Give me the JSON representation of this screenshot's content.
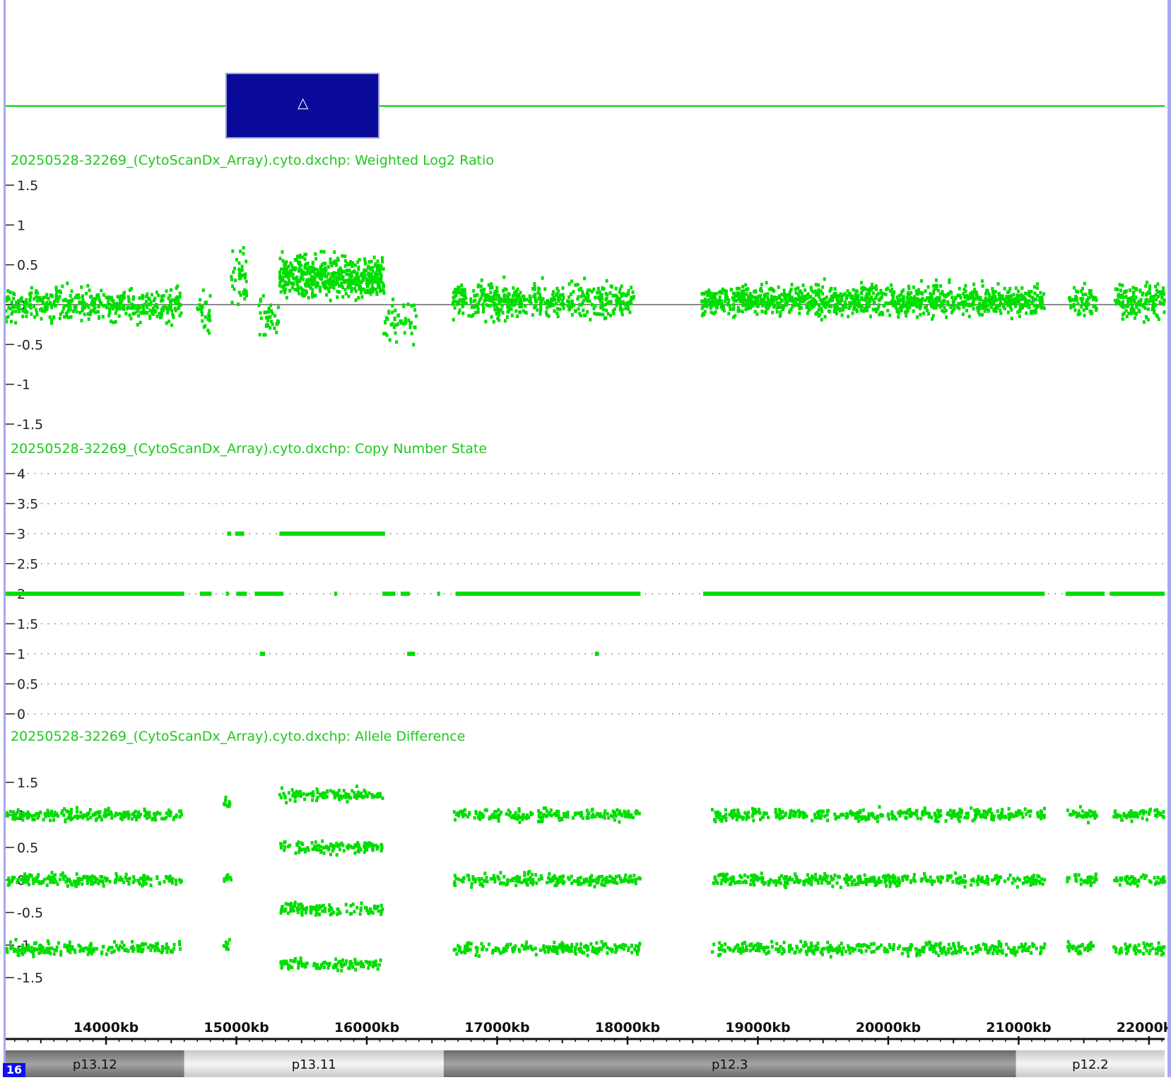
{
  "colors": {
    "points": "#00dd00",
    "title": "#1ec81e",
    "baseline": "#666666",
    "border": "#a8a8ee",
    "segment": "#00cc00"
  },
  "segment_icon": "triangle-up-icon",
  "tracks": {
    "log2_title": "20250528-32269_(CytoScanDx_Array).cyto.dxchp: Weighted Log2 Ratio",
    "cn_title": "20250528-32269_(CytoScanDx_Array).cyto.dxchp: Copy Number State",
    "allele_title": "20250528-32269_(CytoScanDx_Array).cyto.dxchp: Allele Difference"
  },
  "chromosome": "16",
  "chart_data": [
    {
      "type": "scatter",
      "title": "20250528-32269_(CytoScanDx_Array).cyto.dxchp: Weighted Log2 Ratio",
      "ylim": [
        -1.5,
        1.5
      ],
      "yticks": [
        "1.5",
        "1",
        "0.5",
        "0",
        "-0.5",
        "-1",
        "-1.5"
      ],
      "xlim_kb": [
        13230,
        22120
      ],
      "clusters": [
        {
          "x": [
            13230,
            14580
          ],
          "mean": 0.0,
          "spread": 0.2,
          "n": 420
        },
        {
          "x": [
            14700,
            14800
          ],
          "mean": -0.1,
          "spread": 0.25,
          "n": 30
        },
        {
          "x": [
            14960,
            15080
          ],
          "mean": 0.3,
          "spread": 0.35,
          "n": 40
        },
        {
          "x": [
            15170,
            15330
          ],
          "mean": -0.2,
          "spread": 0.25,
          "n": 40
        },
        {
          "x": [
            15330,
            16130
          ],
          "mean": 0.35,
          "spread": 0.25,
          "n": 520
        },
        {
          "x": [
            16130,
            16380
          ],
          "mean": -0.2,
          "spread": 0.3,
          "n": 50
        },
        {
          "x": [
            16650,
            18050
          ],
          "mean": 0.05,
          "spread": 0.2,
          "n": 480
        },
        {
          "x": [
            18570,
            21200
          ],
          "mean": 0.05,
          "spread": 0.18,
          "n": 1100
        },
        {
          "x": [
            21370,
            21600
          ],
          "mean": 0.05,
          "spread": 0.2,
          "n": 60
        },
        {
          "x": [
            21730,
            22120
          ],
          "mean": 0.05,
          "spread": 0.2,
          "n": 150
        }
      ]
    },
    {
      "type": "line",
      "title": "20250528-32269_(CytoScanDx_Array).cyto.dxchp: Copy Number State",
      "ylim": [
        0,
        4
      ],
      "yticks": [
        "4",
        "3.5",
        "3",
        "2.5",
        "2",
        "1.5",
        "1",
        "0.5",
        "0"
      ],
      "segments": [
        {
          "start": 13230,
          "end": 14600,
          "state": 2
        },
        {
          "start": 14720,
          "end": 14810,
          "state": 2
        },
        {
          "start": 14920,
          "end": 14940,
          "state": 2
        },
        {
          "start": 15000,
          "end": 15080,
          "state": 2
        },
        {
          "start": 15140,
          "end": 15360,
          "state": 2
        },
        {
          "start": 14930,
          "end": 14960,
          "state": 3
        },
        {
          "start": 14990,
          "end": 15060,
          "state": 3
        },
        {
          "start": 15330,
          "end": 16140,
          "state": 3
        },
        {
          "start": 15180,
          "end": 15220,
          "state": 1
        },
        {
          "start": 15750,
          "end": 15770,
          "state": 2
        },
        {
          "start": 16120,
          "end": 16220,
          "state": 2
        },
        {
          "start": 16260,
          "end": 16330,
          "state": 2
        },
        {
          "start": 16310,
          "end": 16370,
          "state": 1
        },
        {
          "start": 16540,
          "end": 16560,
          "state": 2
        },
        {
          "start": 16680,
          "end": 18100,
          "state": 2
        },
        {
          "start": 17750,
          "end": 17780,
          "state": 1
        },
        {
          "start": 18580,
          "end": 21200,
          "state": 2
        },
        {
          "start": 21360,
          "end": 21660,
          "state": 2
        },
        {
          "start": 21700,
          "end": 22120,
          "state": 2
        }
      ]
    },
    {
      "type": "scatter",
      "title": "20250528-32269_(CytoScanDx_Array).cyto.dxchp: Allele Difference",
      "ylim": [
        -1.9,
        1.9
      ],
      "yticks": [
        "1.5",
        "1",
        "0.5",
        "0",
        "-0.5",
        "-1",
        "-1.5"
      ],
      "xlim_kb": [
        13230,
        22120
      ],
      "clusters": [
        {
          "x": [
            13230,
            14580
          ],
          "levels": [
            1.0,
            0.0,
            -1.05
          ]
        },
        {
          "x": [
            14900,
            14960
          ],
          "levels": [
            1.2,
            0.0,
            -1.0
          ]
        },
        {
          "x": [
            15330,
            16130
          ],
          "levels": [
            1.3,
            0.5,
            -0.45,
            -1.3
          ]
        },
        {
          "x": [
            16670,
            18100
          ],
          "levels": [
            1.0,
            0.0,
            -1.05
          ]
        },
        {
          "x": [
            18650,
            21200
          ],
          "levels": [
            1.0,
            0.0,
            -1.05
          ]
        },
        {
          "x": [
            21370,
            21600
          ],
          "levels": [
            1.0,
            0.0,
            -1.05
          ]
        },
        {
          "x": [
            21730,
            22120
          ],
          "levels": [
            1.0,
            0.0,
            -1.05
          ]
        }
      ]
    }
  ],
  "x_axis": {
    "labels": [
      "14000kb",
      "15000kb",
      "16000kb",
      "17000kb",
      "18000kb",
      "19000kb",
      "20000kb",
      "21000kb",
      "22000kb"
    ],
    "values_kb": [
      14000,
      15000,
      16000,
      17000,
      18000,
      19000,
      20000,
      21000,
      22000
    ]
  },
  "cytobands": [
    {
      "name": "p13.12",
      "start": 13230,
      "end": 14600,
      "stain": "dark"
    },
    {
      "name": "p13.11",
      "start": 14600,
      "end": 16590,
      "stain": "light"
    },
    {
      "name": "p12.3",
      "start": 16590,
      "end": 20980,
      "stain": "dark"
    },
    {
      "name": "p12.2",
      "start": 20980,
      "end": 22120,
      "stain": "light"
    }
  ]
}
